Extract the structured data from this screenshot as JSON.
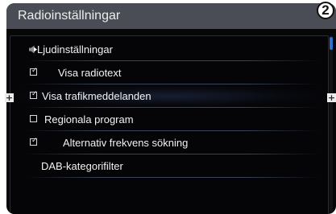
{
  "header": {
    "title": "Radioinställningar"
  },
  "callout": {
    "number": "2"
  },
  "menu": {
    "items": [
      {
        "label": "Ljudinställningar",
        "type": "submenu",
        "icon": "speaker-icon"
      },
      {
        "label": "Visa radiotext",
        "type": "checkbox",
        "checked": true
      },
      {
        "label": "Visa trafikmeddelanden",
        "type": "checkbox",
        "checked": true,
        "selected": true
      },
      {
        "label": "Regionala program",
        "type": "checkbox",
        "checked": false
      },
      {
        "label": "Alternativ frekvens sökning",
        "type": "checkbox",
        "checked": true
      },
      {
        "label": "DAB-kategorifilter",
        "type": "submenu"
      }
    ]
  },
  "controls": {
    "left_plus": "+",
    "right_plus": "+",
    "check_glyph": "✓"
  },
  "colors": {
    "header_bg": "#4a4d55",
    "screen_bg": "#070708",
    "accent_scroll": "#2f6fd6",
    "text": "#f2f2f2"
  }
}
